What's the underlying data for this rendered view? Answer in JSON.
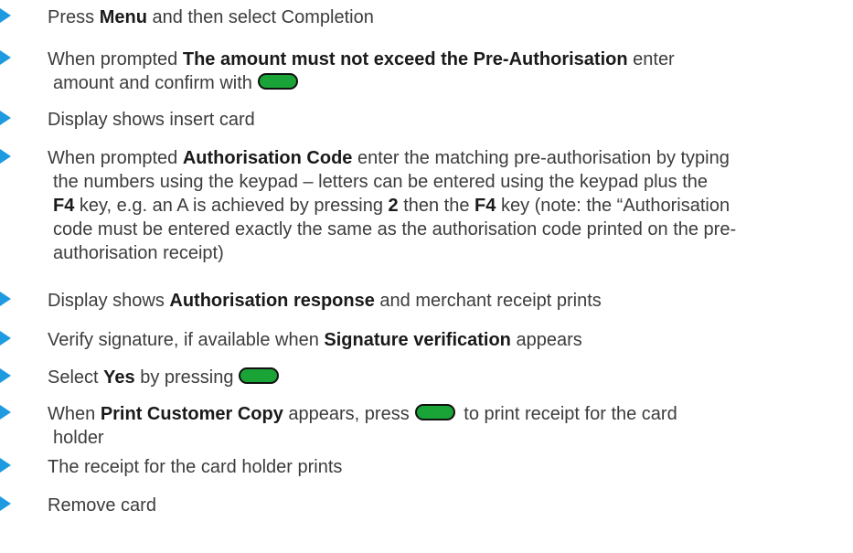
{
  "steps": [
    {
      "pre": "Press ",
      "b1": "Menu",
      "post": " and then select Completion"
    },
    {
      "pre": "When prompted ",
      "b1": "The amount must not exceed the Pre-Authorisation",
      "post": " enter",
      "line2": "amount and confirm with"
    },
    {
      "text": "Display shows insert card"
    },
    {
      "line1_pre": "When prompted ",
      "line1_b": "Authorisation Code",
      "line1_post": " enter the matching pre-authorisation by typing",
      "line2": "the numbers using the keypad – letters can be entered using the keypad plus the",
      "line3_b1": "F4",
      "line3_mid1": " key, e.g. an A is achieved by pressing ",
      "line3_b2": "2",
      "line3_mid2": " then the ",
      "line3_b3": "F4",
      "line3_post": " key (note: the “Authorisation",
      "line4": "code must be entered exactly the same as the authorisation code printed on the pre-",
      "line5": "authorisation receipt)"
    },
    {
      "pre": "Display shows ",
      "b1": "Authorisation response",
      "post": " and merchant receipt prints"
    },
    {
      "pre": "Verify signature, if available when ",
      "b1": "Signature verification",
      "post": " appears"
    },
    {
      "pre": "Select ",
      "b1": "Yes",
      "post": " by pressing"
    },
    {
      "pre": "When ",
      "b1": "Print Customer Copy",
      "mid": " appears, press",
      "post": " to print receipt for the card",
      "line2": "holder"
    },
    {
      "text": "The receipt for the card holder prints"
    },
    {
      "text": "Remove card"
    }
  ],
  "colors": {
    "bullet": "#1e9be0",
    "key_fill": "#1aa336",
    "key_border": "#111111",
    "text": "#3c3c3c"
  },
  "icons": {
    "bullet": "triangle-bullet-icon",
    "key": "green-key-icon"
  }
}
